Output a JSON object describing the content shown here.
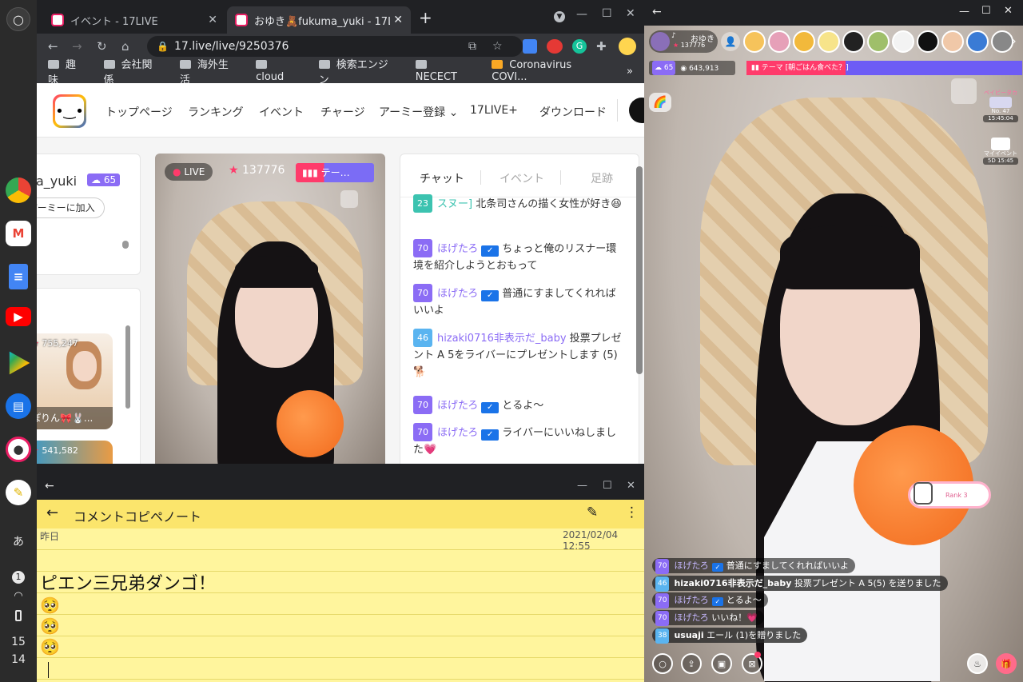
{
  "shelf": {
    "apps": [
      "chrome-icon",
      "gmail-icon",
      "docs-icon",
      "youtube-icon",
      "play-store-icon",
      "messages-icon",
      "17live-icon",
      "notes-icon"
    ],
    "ime": "あ",
    "notification_count": "1",
    "clock_hour": "15",
    "clock_minute": "14"
  },
  "browser": {
    "tabs": [
      {
        "title": "イベント - 17LIVE"
      },
      {
        "title": "おゆき🧸fukuma_yuki - 17LIVE"
      }
    ],
    "url": "17.live/live/9250376",
    "bookmarks": [
      "趣味",
      "会社関係",
      "海外生活",
      "cloud",
      "検索エンジン",
      "NECECT",
      "Coronavirus COVI..."
    ],
    "bookmarks_more": "»"
  },
  "site": {
    "nav": [
      "トップページ",
      "ランキング",
      "イベント",
      "チャージ",
      "アーミー登録",
      "17LIVE+",
      "ダウンロード"
    ],
    "streamer_name": "a_yuki",
    "streamer_level": "65",
    "army_button": "アーミーに加入",
    "rec_stat_1": "755,247",
    "rec_name_1": "ぽりん🎀🐰...",
    "rec_stat_2": "541,582",
    "live_badge": "LIVE",
    "viewer_stat": "137776",
    "theme_chip": "テー…",
    "chat_tabs": [
      "チャット",
      "イベント",
      "足跡"
    ],
    "chat": [
      {
        "level": "23",
        "user": "スヌー]",
        "text": "北条司さんの描く女性が好き😆"
      },
      {
        "level": "70",
        "user": "ほげたろ",
        "text": "ちょっと俺のリスナー環境を紹介しようとおもって"
      },
      {
        "level": "70",
        "user": "ほげたろ",
        "text": "普通にすましてくれればいいよ"
      },
      {
        "level": "46",
        "user": "hizaki0716非表示だ_baby",
        "text": "投票プレゼント A 5をライバーにプレゼントします (5) 🐕"
      },
      {
        "level": "70",
        "user": "ほげたろ",
        "text": "とるよ〜"
      },
      {
        "level": "70",
        "user": "ほげたろ",
        "text": "ライバーにいいねしました💗"
      }
    ]
  },
  "notes": {
    "title": "コメントコピペノート",
    "day": "昨日",
    "timestamp": "2021/02/04 12:55",
    "line1": "ピエン三兄弟ダンゴ！",
    "emoji": [
      "🥺",
      "🥺",
      "🥺"
    ]
  },
  "live": {
    "host_name": "おゆき",
    "host_stat": "137776",
    "host_prefix": "♪",
    "level": "65",
    "points": "643,913",
    "theme": "テーマ [朝ごはん食べた？]",
    "event1_title": "ベイビータカ",
    "event1_rank": "No. 47",
    "event1_time": "15:45:04",
    "event2_title": "マイイベント",
    "event2_time": "5D 15:45",
    "rank_label": "Rank 3",
    "chat": [
      {
        "level": "70",
        "user": "ほげたろ",
        "text": "普通にすましてくれればいいよ"
      },
      {
        "level": "46",
        "user": "hizaki0716非表示だ_baby",
        "text": "投票プレゼント A 5(5) を送りました"
      },
      {
        "level": "70",
        "user": "ほげたろ",
        "text": "とるよ〜"
      },
      {
        "level": "70",
        "user": "ほげたろ",
        "text": "いいね！💗"
      },
      {
        "level": "38",
        "user": "usuaji",
        "text": "エール (1)を贈りました"
      }
    ]
  },
  "colors": {
    "accent_pink": "#ff3b6b",
    "level_purple": "#8b6cf5",
    "level_teal": "#3cc3b0",
    "level_blue": "#5ab4f0",
    "notes_yellow": "#fff59d"
  }
}
